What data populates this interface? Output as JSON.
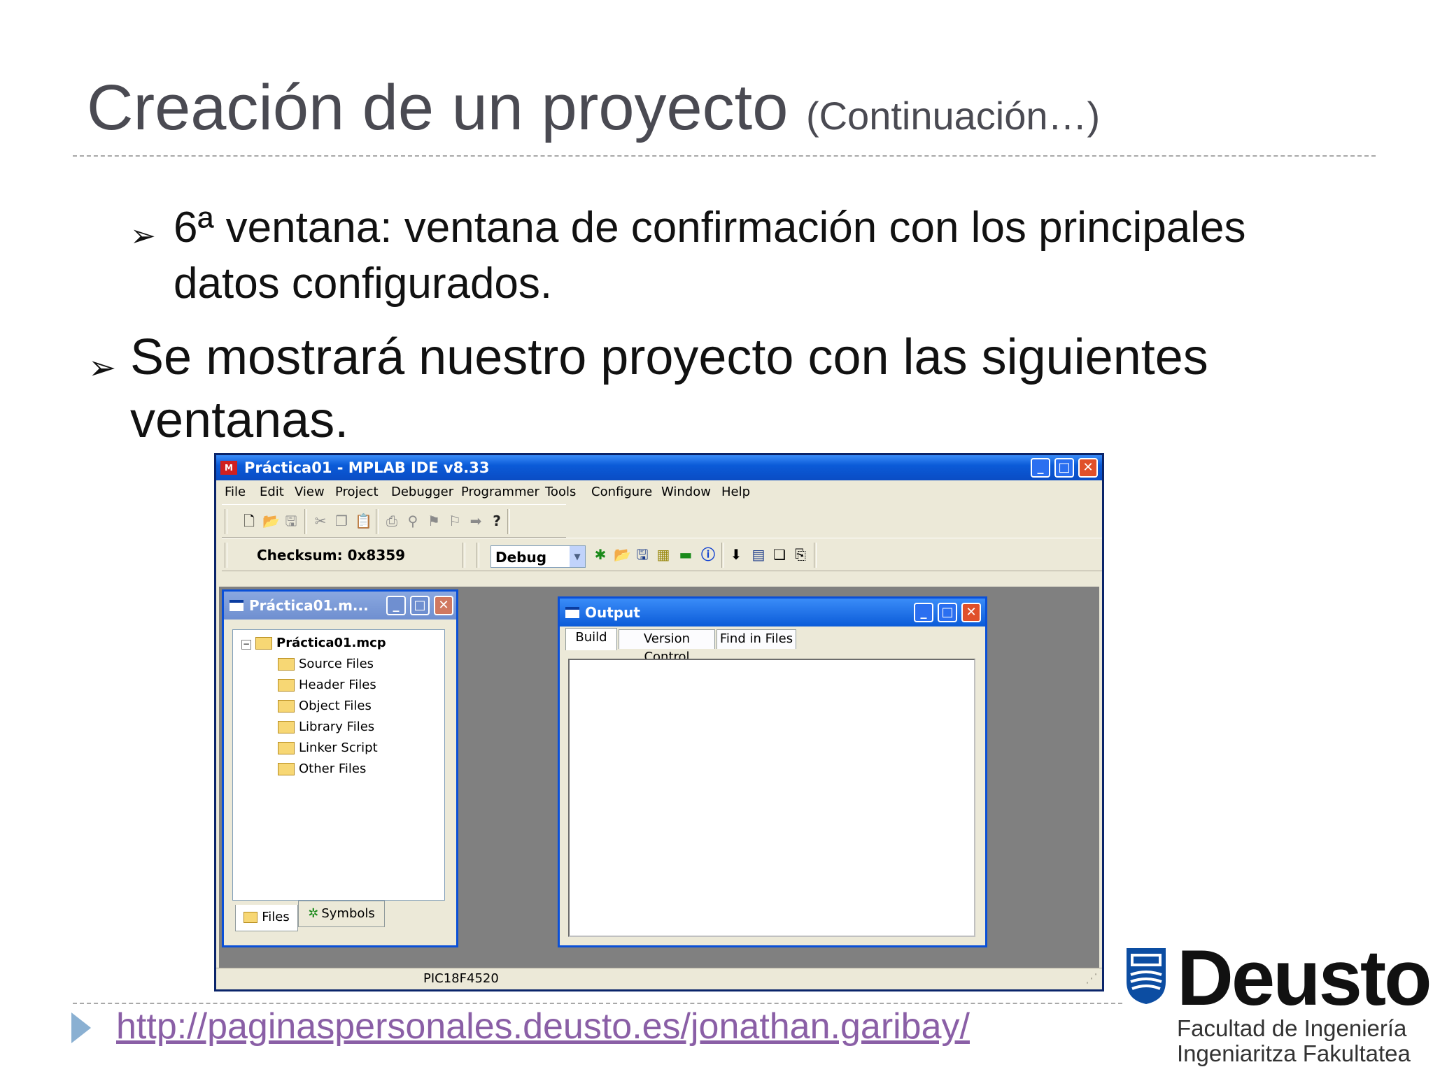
{
  "slide": {
    "title": "Creación de un proyecto",
    "title_suffix": "(Continuación…)",
    "bullets": [
      {
        "mark": "➢",
        "lines": [
          "6ª ventana: ventana de confirmación con los principales",
          "datos configurados."
        ]
      },
      {
        "mark": "➢",
        "lines": [
          "Se mostrará nuestro proyecto con las siguientes",
          "ventanas."
        ]
      }
    ],
    "footer_link": "http://paginaspersonales.deusto.es/jonathan.garibay/",
    "logo": {
      "wordmark": "Deusto",
      "line1": "Facultad de Ingeniería",
      "line2": "Ingeniaritza Fakultatea"
    }
  },
  "ide": {
    "title": "Práctica01 - MPLAB IDE v8.33",
    "window_buttons": {
      "minimize": "_",
      "maximize": "□",
      "close": "✕"
    },
    "menu": [
      "File",
      "Edit",
      "View",
      "Project",
      "Debugger",
      "Programmer",
      "Tools",
      "Configure",
      "Window",
      "Help"
    ],
    "checksum": "Checksum:  0x8359",
    "build_config": "Debug",
    "project_window": {
      "title": "Práctica01.m...",
      "root": "Práctica01.mcp",
      "folders": [
        "Source Files",
        "Header Files",
        "Object Files",
        "Library Files",
        "Linker Script",
        "Other Files"
      ],
      "tabs": [
        "Files",
        "Symbols"
      ]
    },
    "output_window": {
      "title": "Output",
      "tabs": [
        "Build",
        "Version Control",
        "Find in Files"
      ]
    },
    "status": {
      "device": "PIC18F4520"
    }
  }
}
